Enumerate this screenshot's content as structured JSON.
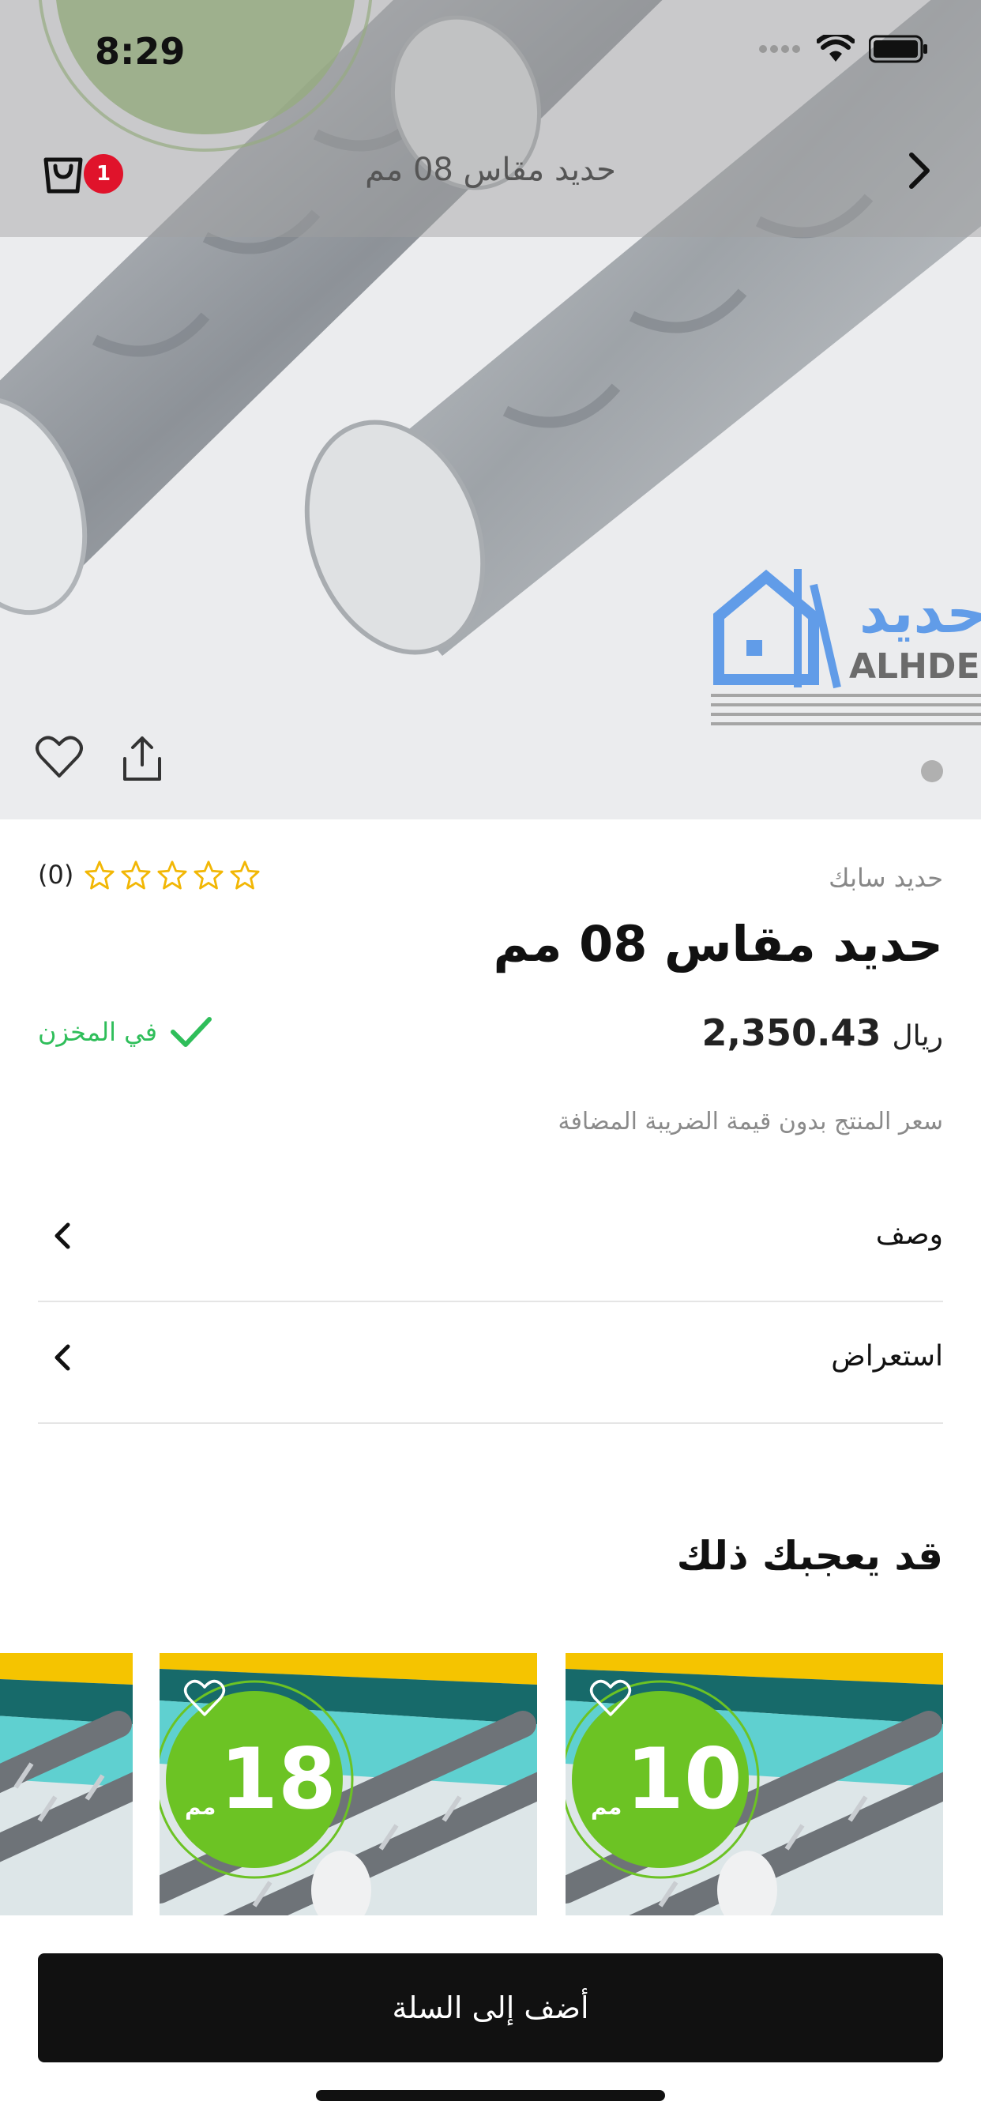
{
  "status_bar": {
    "time": "8:29"
  },
  "header": {
    "title": "حديد مقاس 08 مم",
    "cart_badge": "1"
  },
  "hero": {
    "logo_text_ar": "حديد",
    "logo_text_en": "ALHDEE"
  },
  "product": {
    "brand": "حديد سابك",
    "rating_count": "(0)",
    "stars": 5,
    "title": "حديد مقاس 08 مم",
    "price": "2,350.43",
    "currency": "ريال",
    "stock": "في المخزن",
    "tax_note": "سعر المنتج بدون قيمة الضريبة المضافة"
  },
  "sections": [
    {
      "label": "وصف"
    },
    {
      "label": "استعراض"
    }
  ],
  "recommend": {
    "title": "قد يعجبك ذلك",
    "cards": [
      {
        "size": "10",
        "unit": "مم"
      },
      {
        "size": "18",
        "unit": "مم"
      }
    ]
  },
  "actions": {
    "add_to_cart": "أضف إلى السلة"
  },
  "colors": {
    "accent_green": "#2fbe5a",
    "badge_red": "#e0132b",
    "star_yellow": "#f2b705"
  }
}
